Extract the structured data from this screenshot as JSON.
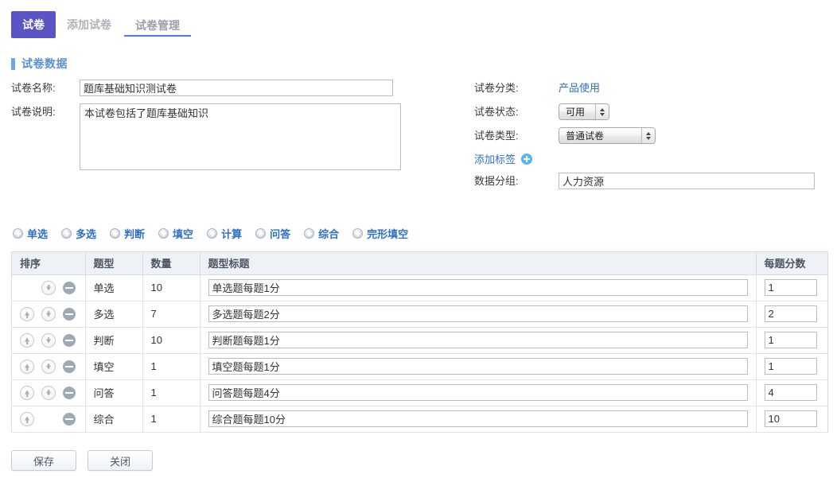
{
  "tabs": [
    {
      "label": "试卷",
      "state": "active"
    },
    {
      "label": "添加试卷",
      "state": "plain"
    },
    {
      "label": "试卷管理",
      "state": "underlined"
    }
  ],
  "section": {
    "title": "试卷数据",
    "accent": "#6aa8e8"
  },
  "form": {
    "left": {
      "name_label": "试卷名称:",
      "name_value": "题库基础知识测试卷",
      "desc_label": "试卷说明:",
      "desc_value": "本试卷包括了题库基础知识"
    },
    "right": {
      "category_label": "试卷分类:",
      "category_value": "产品使用",
      "status_label": "试卷状态:",
      "status_value": "可用",
      "type_label": "试卷类型:",
      "type_value": "普通试卷",
      "addtag_label": "添加标签",
      "addtag_icon": "plus-circle-icon",
      "group_label": "数据分组:",
      "group_value": "人力资源"
    }
  },
  "question_type_toolbar": {
    "icon": "plus-icon",
    "items": [
      {
        "label": "单选"
      },
      {
        "label": "多选"
      },
      {
        "label": "判断"
      },
      {
        "label": "填空"
      },
      {
        "label": "计算"
      },
      {
        "label": "问答"
      },
      {
        "label": "综合"
      },
      {
        "label": "完形填空"
      }
    ]
  },
  "table": {
    "columns": [
      "排序",
      "题型",
      "数量",
      "题型标题",
      "每题分数"
    ],
    "rows": [
      {
        "up": false,
        "down": true,
        "remove": true,
        "type": "单选",
        "count": "10",
        "title": "单选题每题1分",
        "score": "1"
      },
      {
        "up": true,
        "down": true,
        "remove": true,
        "type": "多选",
        "count": "7",
        "title": "多选题每题2分",
        "score": "2"
      },
      {
        "up": true,
        "down": true,
        "remove": true,
        "type": "判断",
        "count": "10",
        "title": "判断题每题1分",
        "score": "1"
      },
      {
        "up": true,
        "down": true,
        "remove": true,
        "type": "填空",
        "count": "1",
        "title": "填空题每题1分",
        "score": "1"
      },
      {
        "up": true,
        "down": true,
        "remove": true,
        "type": "问答",
        "count": "1",
        "title": "问答题每题4分",
        "score": "4"
      },
      {
        "up": true,
        "down": false,
        "remove": true,
        "type": "综合",
        "count": "1",
        "title": "综合题每题10分",
        "score": "10"
      }
    ]
  },
  "footer": {
    "save_label": "保存",
    "close_label": "关闭"
  },
  "colors": {
    "tab_active_bg": "#5b54c4",
    "link": "#2f6fc4",
    "underline": "#4a7fe0",
    "header_bg": "#eef1f6",
    "plus_blue": "#56b4ef"
  }
}
